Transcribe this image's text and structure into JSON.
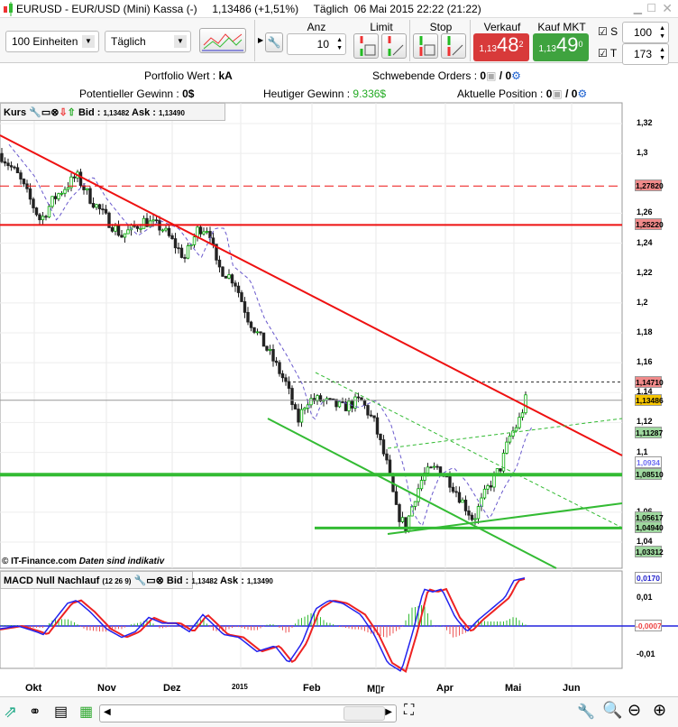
{
  "window": {
    "title": "EURUSD - EUR/USD (Mini) Kassa (-)",
    "last": "1,13486 (+1,51%)",
    "period": "Täglich",
    "datetime": "06 Mai 2015 22:22 (21:22)"
  },
  "toolbar": {
    "units": "100 Einheiten",
    "interval": "Täglich",
    "anz_label": "Anz",
    "anz_value": "10",
    "limit_label": "Limit",
    "stop_label": "Stop",
    "sell_label": "Verkauf MKT",
    "sell_prefix": "1,13",
    "sell_big": "48",
    "sell_sup": "2",
    "buy_label": "Kauf MKT",
    "buy_prefix": "1,13",
    "buy_big": "49",
    "buy_sup": "0",
    "s_label": "S",
    "s_value": "100",
    "t_label": "T",
    "t_value": "173"
  },
  "info": {
    "portfolio_label": "Portfolio Wert : ",
    "portfolio_value": "kA",
    "pending_label": "Schwebende Orders : ",
    "pending_value": "0",
    "pending_value2": "0",
    "pending_sep": " / ",
    "pot_label": "Potentieller Gewinn : ",
    "pot_value": "0$",
    "today_label": "Heutiger Gewinn : ",
    "today_value": "9.336$",
    "pos_label": "Aktuelle Position : ",
    "pos_value": "0",
    "pos_value2": "0",
    "pos_sep": " / "
  },
  "chart": {
    "panel_title": "Kurs",
    "bid_label": "Bid : ",
    "bid": "1,13482",
    "ask_label": " Ask : ",
    "ask": "1,13490",
    "credit": "© IT-Finance.com",
    "disclaimer": "Daten sind indikativ",
    "y_ticks": [
      "1,32",
      "1,3",
      "1,26",
      "1,24",
      "1,22",
      "1,2",
      "1,18",
      "1,16",
      "1,14",
      "1,12",
      "1,1",
      "1,06",
      "1,04"
    ],
    "y_tick_values": [
      1.32,
      1.3,
      1.26,
      1.24,
      1.22,
      1.2,
      1.18,
      1.16,
      1.14,
      1.12,
      1.1,
      1.06,
      1.04
    ],
    "tags": [
      {
        "text": "1,27820",
        "v": 1.2782,
        "bg": "#f08a8a"
      },
      {
        "text": "1,25220",
        "v": 1.2522,
        "bg": "#f08a8a"
      },
      {
        "text": "1,14710",
        "v": 1.1471,
        "bg": "#f08a8a"
      },
      {
        "text": "1,13486",
        "v": 1.13486,
        "bg": "#f5c400"
      },
      {
        "text": "1,11287",
        "v": 1.11287,
        "bg": "#9fd89f"
      },
      {
        "text": "1,0934",
        "v": 1.0934,
        "bg": "#fff",
        "fg": "#6a6af0"
      },
      {
        "text": "1,08510",
        "v": 1.0851,
        "bg": "#9fd89f"
      },
      {
        "text": "1,05617",
        "v": 1.05617,
        "bg": "#9fd89f"
      },
      {
        "text": "1,04940",
        "v": 1.0494,
        "bg": "#9fd89f"
      },
      {
        "text": "1,03312",
        "v": 1.03312,
        "bg": "#9fd89f"
      }
    ],
    "price_path": [
      [
        0,
        1.3
      ],
      [
        20,
        1.285
      ],
      [
        45,
        1.255
      ],
      [
        60,
        1.27
      ],
      [
        85,
        1.285
      ],
      [
        100,
        1.27
      ],
      [
        120,
        1.255
      ],
      [
        135,
        1.245
      ],
      [
        160,
        1.255
      ],
      [
        180,
        1.25
      ],
      [
        205,
        1.23
      ],
      [
        220,
        1.25
      ],
      [
        232,
        1.25
      ],
      [
        240,
        1.225
      ],
      [
        260,
        1.215
      ],
      [
        275,
        1.19
      ],
      [
        300,
        1.165
      ],
      [
        318,
        1.145
      ],
      [
        330,
        1.12
      ],
      [
        340,
        1.135
      ],
      [
        355,
        1.135
      ],
      [
        380,
        1.13
      ],
      [
        400,
        1.135
      ],
      [
        415,
        1.12
      ],
      [
        430,
        1.09
      ],
      [
        440,
        1.06
      ],
      [
        450,
        1.05
      ],
      [
        460,
        1.07
      ],
      [
        470,
        1.085
      ],
      [
        485,
        1.09
      ],
      [
        500,
        1.08
      ],
      [
        515,
        1.065
      ],
      [
        525,
        1.055
      ],
      [
        540,
        1.075
      ],
      [
        555,
        1.09
      ],
      [
        565,
        1.11
      ],
      [
        575,
        1.12
      ],
      [
        583,
        1.135
      ]
    ],
    "colors": {
      "up": "#00aa00",
      "down": "#222",
      "trend_red": "#ee1111",
      "support_green": "#33bb33"
    }
  },
  "macd": {
    "title": "MACD Null Nachlauf",
    "params": "(12 26 9)",
    "bid_label": "Bid : ",
    "bid": "1,13482",
    "ask_label": " Ask : ",
    "ask": "1,13490",
    "y_ticks": [
      "0,01",
      "-0,01"
    ],
    "y_tick_values": [
      0.01,
      -0.01
    ],
    "tag_signal": "0,0170",
    "tag_hist": "-0,0007",
    "path": [
      [
        0,
        -0.001
      ],
      [
        20,
        0
      ],
      [
        40,
        -0.002
      ],
      [
        48,
        -0.003
      ],
      [
        60,
        0.002
      ],
      [
        75,
        0.008
      ],
      [
        85,
        0.009
      ],
      [
        100,
        0.005
      ],
      [
        118,
        -0.001
      ],
      [
        135,
        -0.004
      ],
      [
        150,
        -0.002
      ],
      [
        165,
        0.003
      ],
      [
        180,
        0.001
      ],
      [
        195,
        0.001
      ],
      [
        210,
        -0.002
      ],
      [
        225,
        0.004
      ],
      [
        235,
        0.001
      ],
      [
        248,
        -0.003
      ],
      [
        265,
        -0.004
      ],
      [
        285,
        -0.009
      ],
      [
        305,
        -0.007
      ],
      [
        320,
        -0.013
      ],
      [
        335,
        -0.006
      ],
      [
        350,
        0.006
      ],
      [
        365,
        0.009
      ],
      [
        380,
        0.008
      ],
      [
        400,
        0.004
      ],
      [
        415,
        -0.003
      ],
      [
        430,
        -0.013
      ],
      [
        445,
        -0.016
      ],
      [
        458,
        -0.002
      ],
      [
        470,
        0.013
      ],
      [
        480,
        0.012
      ],
      [
        490,
        0.013
      ],
      [
        505,
        0.003
      ],
      [
        518,
        -0.002
      ],
      [
        530,
        0.002
      ],
      [
        545,
        0.006
      ],
      [
        560,
        0.01
      ],
      [
        570,
        0.016
      ],
      [
        583,
        0.017
      ]
    ]
  },
  "xaxis": {
    "labels": [
      "Okt",
      "Nov",
      "Dez",
      "2015",
      "Feb",
      "M▯r",
      "Apr",
      "Mai",
      "Jun"
    ]
  }
}
